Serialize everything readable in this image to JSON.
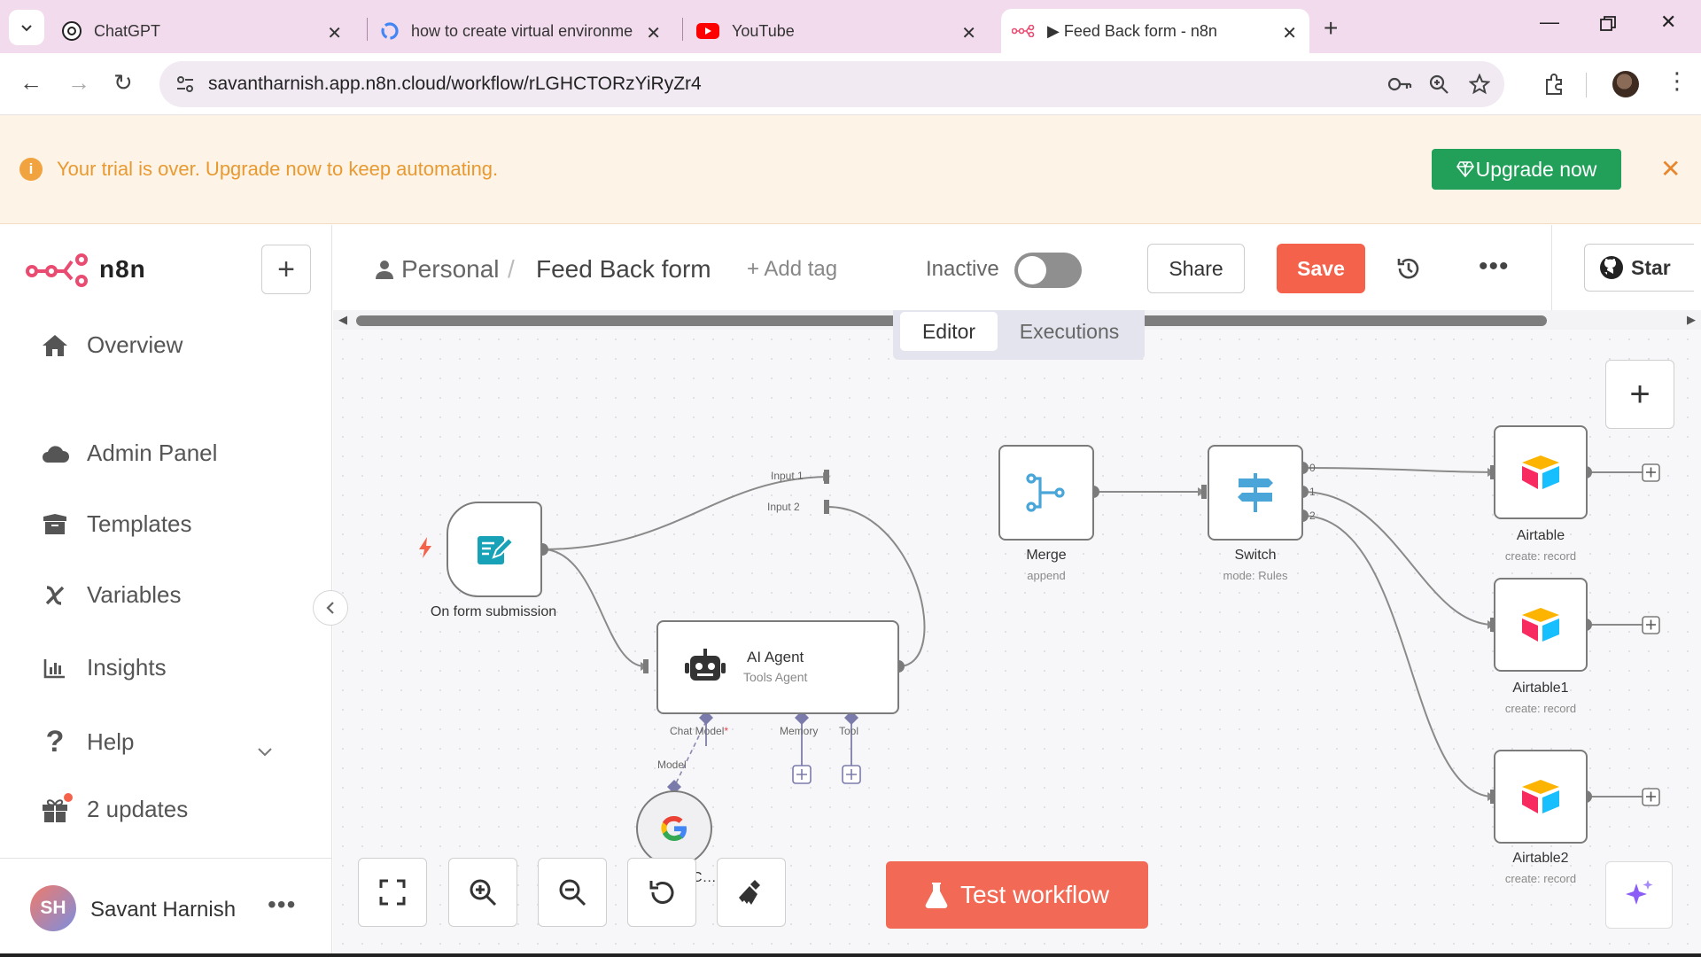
{
  "browser": {
    "tabs": [
      {
        "title": "ChatGPT"
      },
      {
        "title": "how to create virtual environme"
      },
      {
        "title": "YouTube"
      },
      {
        "title": "▶ Feed Back form - n8n"
      }
    ],
    "url": "savantharnish.app.n8n.cloud/workflow/rLGHCTORzYiRyZr4"
  },
  "banner": {
    "message": "Your trial is over. Upgrade now to keep automating.",
    "upgrade_label": "Upgrade now",
    "close": "✕"
  },
  "sidebar": {
    "logo_text": "n8n",
    "add": "+",
    "items": [
      {
        "label": "Overview",
        "icon": "home-icon"
      },
      {
        "label": "Admin Panel",
        "icon": "cloud-icon"
      },
      {
        "label": "Templates",
        "icon": "box-icon"
      },
      {
        "label": "Variables",
        "icon": "variable-icon"
      },
      {
        "label": "Insights",
        "icon": "chart-icon"
      },
      {
        "label": "Help",
        "icon": "question-icon"
      },
      {
        "label": "2 updates",
        "icon": "gift-icon"
      }
    ],
    "user": {
      "initials": "SH",
      "name": "Savant Harnish"
    }
  },
  "header": {
    "project": "Personal",
    "workflow_name": "Feed Back form",
    "add_tag": "+ Add tag",
    "status": "Inactive",
    "share": "Share",
    "save": "Save",
    "star": "Star"
  },
  "canvas": {
    "tabs": {
      "editor": "Editor",
      "executions": "Executions"
    },
    "nodes": {
      "trigger": {
        "label": "On form submission"
      },
      "agent": {
        "title": "AI Agent",
        "subtitle": "Tools Agent"
      },
      "merge": {
        "label": "Merge",
        "subtitle": "append"
      },
      "switch": {
        "label": "Switch",
        "subtitle": "mode: Rules"
      },
      "airtable": {
        "label": "Airtable",
        "subtitle": "create: record"
      },
      "airtable1": {
        "label": "Airtable1",
        "subtitle": "create: record"
      },
      "airtable2": {
        "label": "Airtable2",
        "subtitle": "create: record"
      },
      "gemini": {
        "label": "Goo… ni C…"
      }
    },
    "ports": {
      "input1": "Input 1",
      "input2": "Input 2",
      "out0": "0",
      "out1": "1",
      "out2": "2",
      "chat_model": "Chat Model",
      "required_mark": "*",
      "memory": "Memory",
      "tool": "Tool",
      "model": "Model"
    },
    "test_workflow": "Test workflow"
  },
  "colors": {
    "accent": "#f4624c",
    "upgrade": "#22a05a",
    "banner_text": "#e89a31",
    "tabbar": "#f3dbee"
  }
}
